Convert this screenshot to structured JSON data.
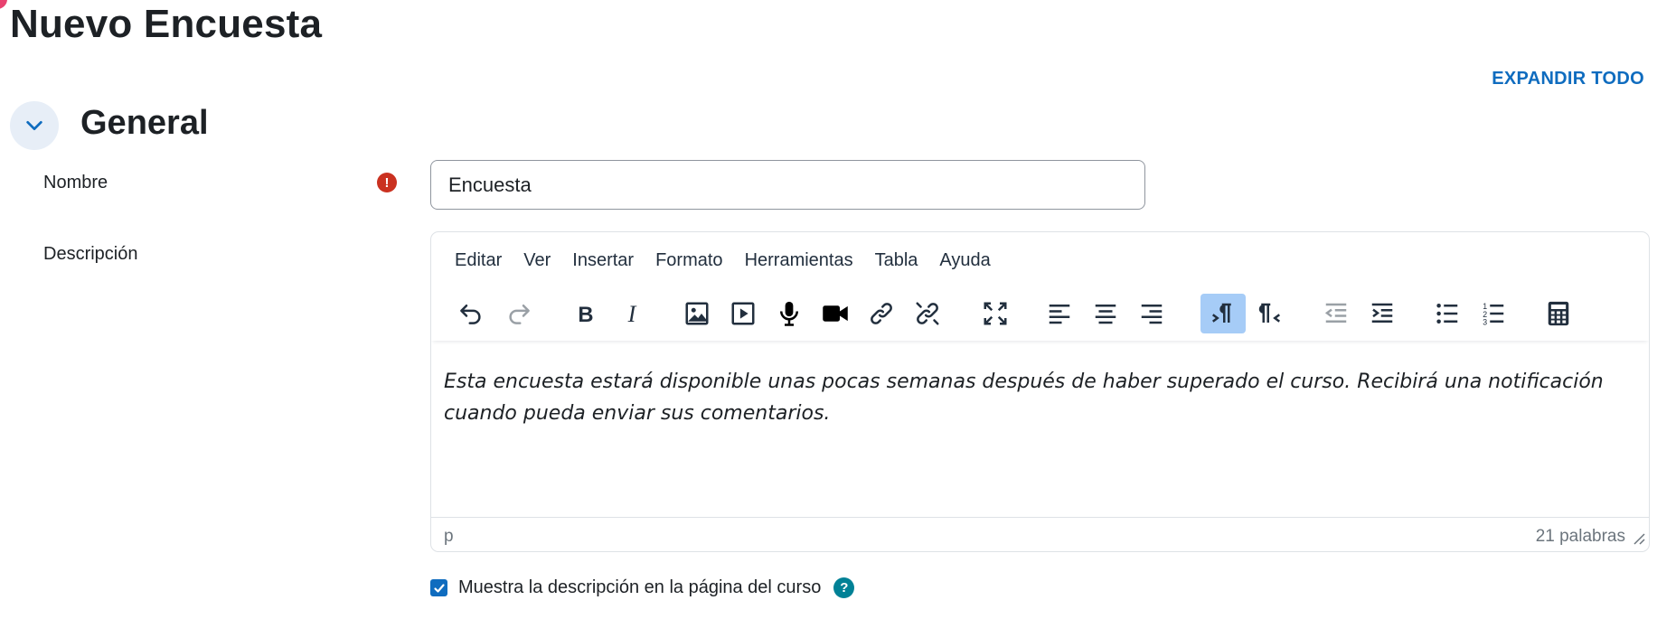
{
  "page": {
    "title": "Nuevo Encuesta",
    "expand_all_label": "EXPANDIR TODO"
  },
  "section": {
    "title": "General"
  },
  "form": {
    "name_label": "Nombre",
    "name_value": "Encuesta",
    "description_label": "Descripción",
    "required_glyph": "!"
  },
  "editor": {
    "menu": [
      "Editar",
      "Ver",
      "Insertar",
      "Formato",
      "Herramientas",
      "Tabla",
      "Ayuda"
    ],
    "toolbar_icons": [
      "undo-icon",
      "redo-icon",
      "bold-icon",
      "italic-icon",
      "image-icon",
      "media-icon",
      "record-audio-icon",
      "record-video-icon",
      "link-icon",
      "unlink-icon",
      "fullscreen-icon",
      "align-left-icon",
      "align-center-icon",
      "align-right-icon",
      "ltr-icon",
      "rtl-icon",
      "outdent-icon",
      "indent-icon",
      "bullet-list-icon",
      "numbered-list-icon",
      "equation-editor-icon"
    ],
    "active_toolbar_icon": "ltr-icon",
    "content": "Esta encuesta estará disponible unas pocas semanas después de haber superado el curso. Recibirá una notificación cuando pueda enviar sus comentarios.",
    "status_path": "p",
    "word_count": "21 palabras"
  },
  "show_description": {
    "label": "Muestra la descripción en la página del curso",
    "checked": true,
    "help_glyph": "?"
  },
  "colors": {
    "accent": "#0f6cbf",
    "required": "#ca3120",
    "help": "#008196",
    "active_button": "#a6ccf7"
  }
}
